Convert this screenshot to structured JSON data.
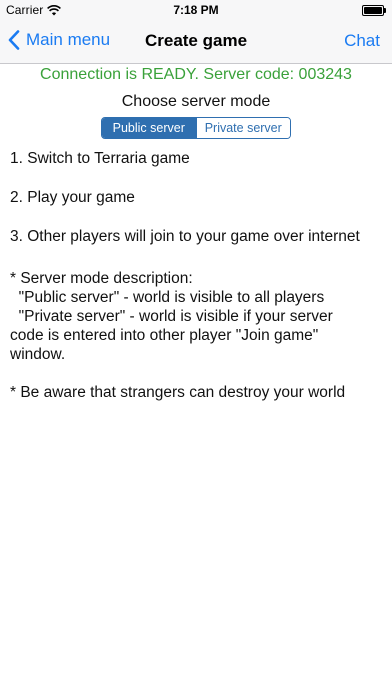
{
  "status_bar": {
    "carrier": "Carrier",
    "time": "7:18 PM",
    "wifi_icon": "wifi-icon",
    "battery_icon": "battery-icon",
    "battery_level": 1.0
  },
  "nav": {
    "back_label": "Main menu",
    "back_icon": "chevron-left-icon",
    "title": "Create game",
    "chat_label": "Chat"
  },
  "connection": {
    "text": "Connection is READY. Server code: 003243",
    "color": "#3aa13a"
  },
  "server_mode": {
    "heading": "Choose server mode",
    "options": [
      "Public server",
      "Private server"
    ],
    "selected": "Public server"
  },
  "steps": [
    "1. Switch to Terraria game",
    "2. Play your game",
    "3. Other players will join to your game over internet"
  ],
  "description": {
    "lines": [
      "* Server mode description:",
      "  \"Public server\" - world is visible to all players",
      "  \"Private server\" - world is visible if your server",
      "code is entered into other player \"Join game\"",
      "window."
    ]
  },
  "warning": "* Be aware that strangers can destroy your world",
  "colors": {
    "accent": "#1a7bf2",
    "segment": "#2f6fb0",
    "navbar_bg": "#f7f7f8"
  }
}
